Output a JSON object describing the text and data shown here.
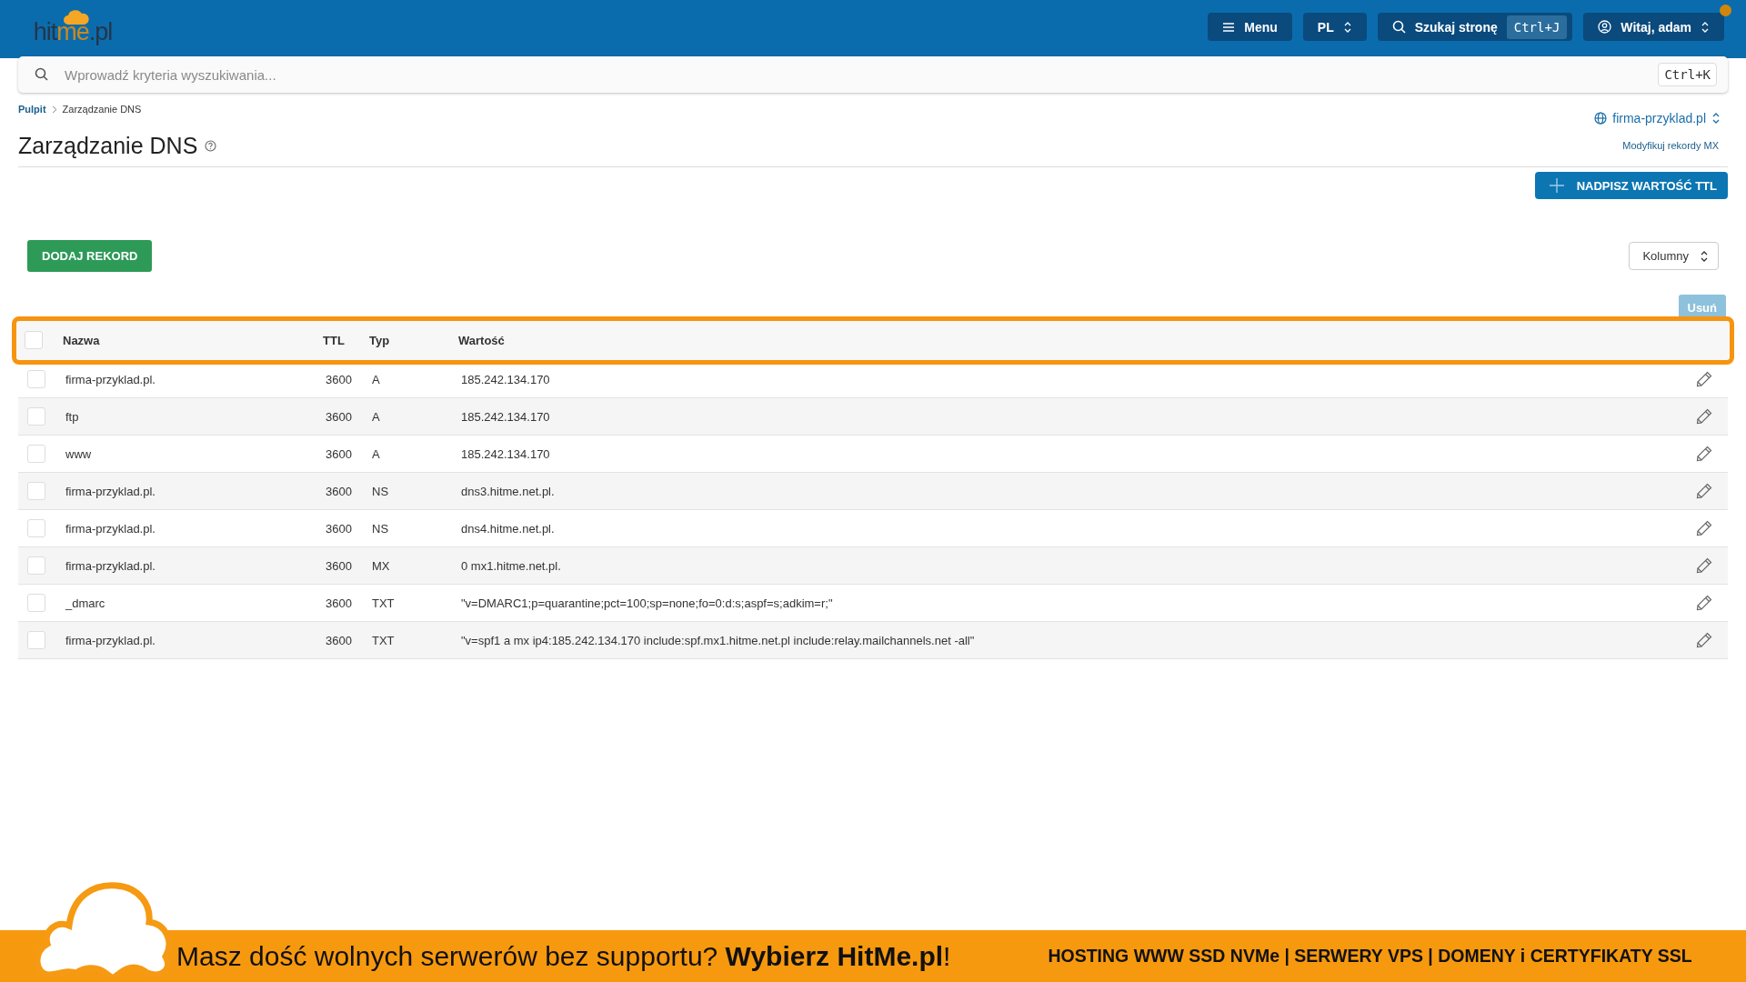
{
  "topbar": {
    "logo_parts": [
      "hit",
      "me",
      ".pl"
    ],
    "menu_button": "Menu",
    "language": "PL",
    "page_search": {
      "label": "Szukaj stronę",
      "shortcut": "Ctrl+J"
    },
    "user_menu": {
      "label": "Witaj, adam",
      "notification": true
    }
  },
  "search": {
    "placeholder": "Wprowadź kryteria wyszukiwania...",
    "shortcut": "Ctrl+K"
  },
  "breadcrumb": [
    "Pulpit",
    "Zarządzanie DNS"
  ],
  "domain_selector": "firma-przyklad.pl",
  "title": "Zarządzanie DNS",
  "mx_link": "Modyfikuj rekordy MX",
  "ttl_button": "NADPISZ WARTOŚĆ TTL",
  "add_button": "DODAJ REKORD",
  "columns_select": "Kolumny",
  "delete_button": {
    "label": "Usuń",
    "disabled": true
  },
  "table": {
    "highlighted": true,
    "select_all_checked": false,
    "columns": [
      "Nazwa",
      "TTL",
      "Typ",
      "Wartość"
    ],
    "rows": [
      {
        "cells": [
          "firma-przyklad.pl.",
          "3600",
          "A",
          "185.242.134.170"
        ],
        "checked": false
      },
      {
        "cells": [
          "ftp",
          "3600",
          "A",
          "185.242.134.170"
        ],
        "checked": false
      },
      {
        "cells": [
          "www",
          "3600",
          "A",
          "185.242.134.170"
        ],
        "checked": false
      },
      {
        "cells": [
          "firma-przyklad.pl.",
          "3600",
          "NS",
          "dns3.hitme.net.pl."
        ],
        "checked": false
      },
      {
        "cells": [
          "firma-przyklad.pl.",
          "3600",
          "NS",
          "dns4.hitme.net.pl."
        ],
        "checked": false
      },
      {
        "cells": [
          "firma-przyklad.pl.",
          "3600",
          "MX",
          "0 mx1.hitme.net.pl."
        ],
        "checked": false
      },
      {
        "cells": [
          "_dmarc",
          "3600",
          "TXT",
          "\"v=DMARC1;p=quarantine;pct=100;sp=none;fo=0:d:s;aspf=s;adkim=r;\""
        ],
        "checked": false
      },
      {
        "cells": [
          "firma-przyklad.pl.",
          "3600",
          "TXT",
          "\"v=spf1 a mx ip4:185.242.134.170 include:spf.mx1.hitme.net.pl include:relay.mailchannels.net -all\""
        ],
        "checked": false
      }
    ]
  },
  "banner": {
    "headline": "Masz dość wolnych serwerów bez supportu? **Wybierz HitMe.pl**!",
    "services": "HOSTING WWW SSD NVMe | SERWERY VPS | DOMENY i CERTYFIKATY SSL"
  }
}
